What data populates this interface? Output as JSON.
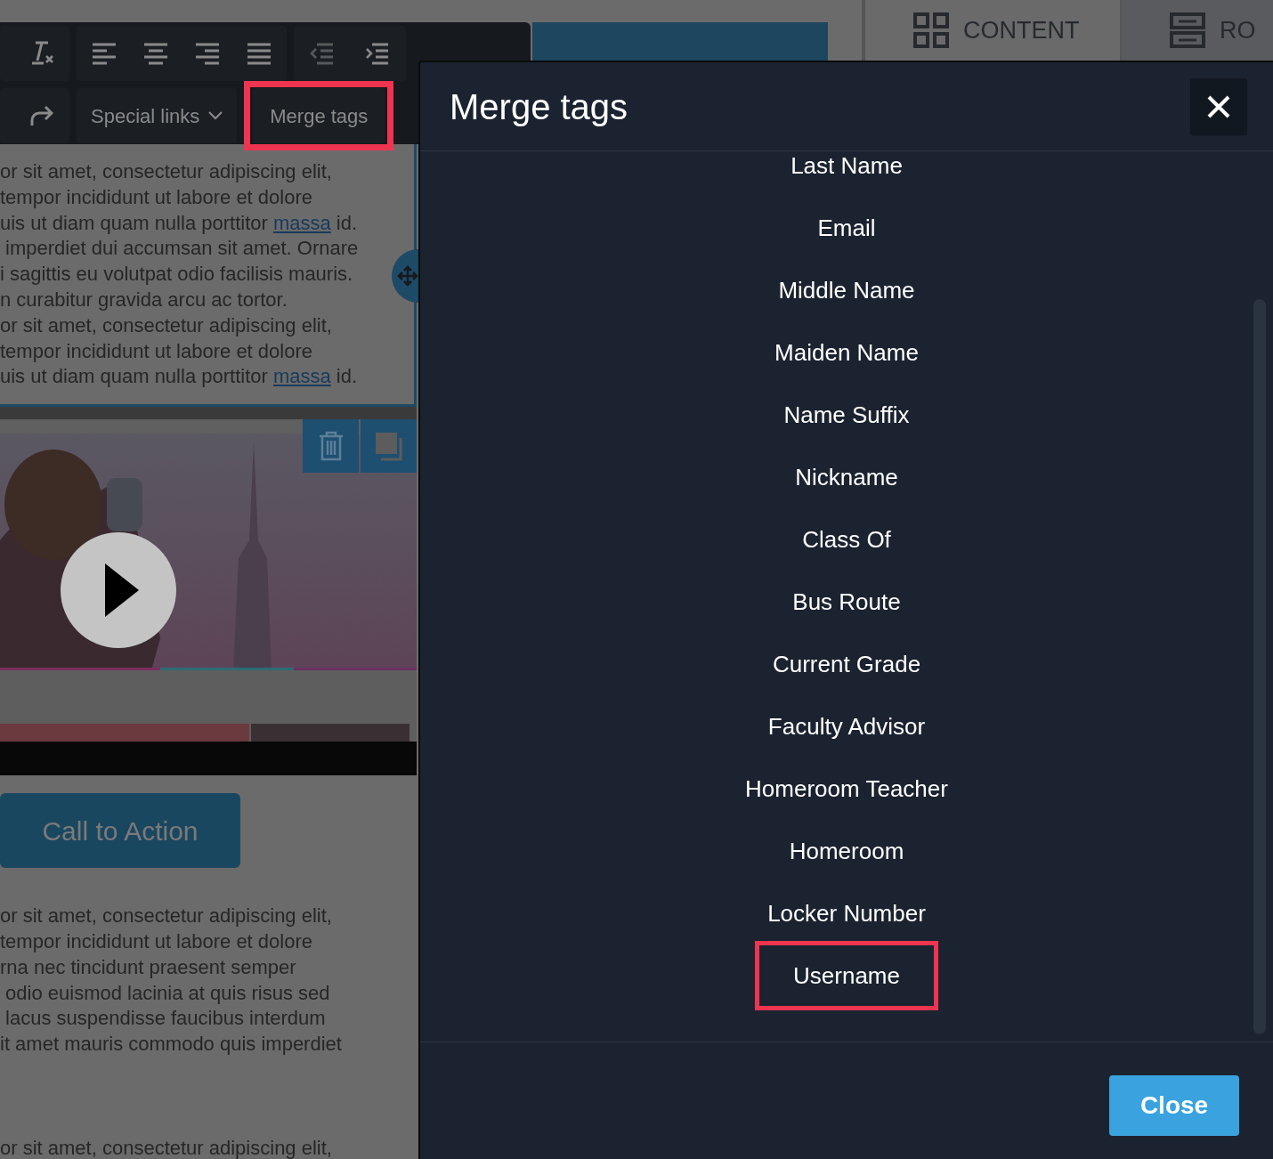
{
  "toolbar": {
    "special_links": "Special links",
    "merge_tags": {
      "label": "Merge tags",
      "highlighted": true
    }
  },
  "tabs": [
    {
      "label": "CONTENT",
      "selected": true
    },
    {
      "label": "RO",
      "selected": false
    }
  ],
  "editor": {
    "blocks": [
      {
        "kind": "text",
        "selected": true,
        "lines": [
          {
            "text": "or sit amet, consectetur adipiscing elit,"
          },
          {
            "text": "tempor incididunt ut labore et dolore"
          },
          {
            "text": "uis ut diam quam nulla porttitor ",
            "link": "massa",
            "after": " id."
          },
          {
            "text": " imperdiet dui accumsan sit amet. Ornare"
          },
          {
            "text": "i sagittis eu volutpat odio facilisis mauris."
          },
          {
            "text": "n curabitur gravida arcu ac tortor."
          },
          {
            "text": "or sit amet, consectetur adipiscing elit,"
          },
          {
            "text": "tempor incididunt ut labore et dolore"
          },
          {
            "text": "uis ut diam quam nulla porttitor ",
            "link": "massa",
            "after": " id."
          }
        ]
      },
      {
        "kind": "video"
      },
      {
        "kind": "button",
        "label": "Call to Action"
      },
      {
        "kind": "text",
        "selected": false,
        "lines": [
          {
            "text": "or sit amet, consectetur adipiscing elit,"
          },
          {
            "text": "tempor incididunt ut labore et dolore"
          },
          {
            "text": "rna nec tincidunt praesent semper"
          },
          {
            "text": " odio euismod lacinia at quis risus sed"
          },
          {
            "text": " lacus suspendisse faucibus interdum"
          },
          {
            "text": "it amet mauris commodo quis imperdiet"
          }
        ]
      },
      {
        "kind": "text",
        "selected": false,
        "lines": [
          {
            "text": "or sit amet, consectetur adipiscing elit,"
          }
        ]
      }
    ]
  },
  "modal": {
    "title": "Merge tags",
    "items": [
      {
        "label": "Last Name",
        "highlighted": false
      },
      {
        "label": "Email",
        "highlighted": false
      },
      {
        "label": "Middle Name",
        "highlighted": false
      },
      {
        "label": "Maiden Name",
        "highlighted": false
      },
      {
        "label": "Name Suffix",
        "highlighted": false
      },
      {
        "label": "Nickname",
        "highlighted": false
      },
      {
        "label": "Class Of",
        "highlighted": false
      },
      {
        "label": "Bus Route",
        "highlighted": false
      },
      {
        "label": "Current Grade",
        "highlighted": false
      },
      {
        "label": "Faculty Advisor",
        "highlighted": false
      },
      {
        "label": "Homeroom Teacher",
        "highlighted": false
      },
      {
        "label": "Homeroom",
        "highlighted": false
      },
      {
        "label": "Locker Number",
        "highlighted": false
      },
      {
        "label": "Username",
        "highlighted": true
      }
    ],
    "close_button": "Close"
  }
}
